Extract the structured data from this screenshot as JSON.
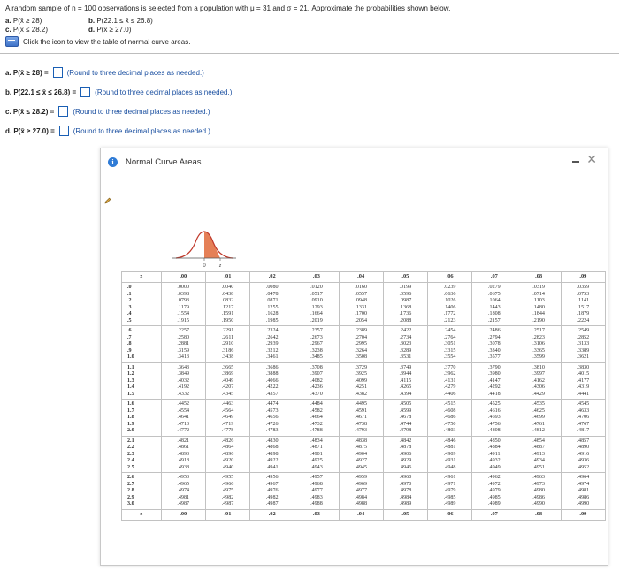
{
  "question": {
    "intro": "A random sample of n = 100 observations is selected from a population with μ = 31 and σ = 21. Approximate the probabilities shown below.",
    "parts": [
      {
        "label": "a.",
        "expr": "P(x̄ ≥ 28)"
      },
      {
        "label": "b.",
        "expr": "P(22.1 ≤ x̄ ≤ 26.8)"
      },
      {
        "label": "c.",
        "expr": "P(x̄ ≤ 28.2)"
      },
      {
        "label": "d.",
        "expr": "P(x̄ ≥ 27.0)"
      }
    ],
    "icon_note": "Click the icon to view the table of normal curve areas."
  },
  "answers": [
    {
      "label": "a. P(x̄ ≥ 28) =",
      "hint": "(Round to three decimal places as needed.)"
    },
    {
      "label": "b. P(22.1 ≤ x̄ ≤ 26.8) =",
      "hint": "(Round to three decimal places as needed.)"
    },
    {
      "label": "c. P(x̄ ≤ 28.2) =",
      "hint": "(Round to three decimal places as needed.)"
    },
    {
      "label": "d. P(x̄ ≥ 27.0) =",
      "hint": "(Round to three decimal places as needed.)"
    }
  ],
  "dialog": {
    "title": "Normal Curve Areas",
    "icons": {
      "info": "info-icon",
      "minimize": "minimize-icon",
      "close": "close-icon",
      "edit": "pencil-icon"
    },
    "curve_labels": {
      "zero": "0",
      "z": "z"
    },
    "table": {
      "headers": [
        "z",
        ".00",
        ".01",
        ".02",
        ".03",
        ".04",
        ".05",
        ".06",
        ".07",
        ".08",
        ".09"
      ],
      "footer": [
        "z",
        ".00",
        ".01",
        ".02",
        ".03",
        ".04",
        ".05",
        ".06",
        ".07",
        ".08",
        ".09"
      ],
      "groups": [
        {
          "z": [
            ".0",
            ".1",
            ".2",
            ".3",
            ".4",
            ".5"
          ],
          "cols": [
            [
              ".0000",
              ".0398",
              ".0793",
              ".1179",
              ".1554",
              ".1915"
            ],
            [
              ".0040",
              ".0438",
              ".0832",
              ".1217",
              ".1591",
              ".1950"
            ],
            [
              ".0080",
              ".0478",
              ".0871",
              ".1255",
              ".1628",
              ".1985"
            ],
            [
              ".0120",
              ".0517",
              ".0910",
              ".1293",
              ".1664",
              ".2019"
            ],
            [
              ".0160",
              ".0557",
              ".0948",
              ".1331",
              ".1700",
              ".2054"
            ],
            [
              ".0199",
              ".0596",
              ".0987",
              ".1368",
              ".1736",
              ".2088"
            ],
            [
              ".0239",
              ".0636",
              ".1026",
              ".1406",
              ".1772",
              ".2123"
            ],
            [
              ".0279",
              ".0675",
              ".1064",
              ".1443",
              ".1808",
              ".2157"
            ],
            [
              ".0319",
              ".0714",
              ".1103",
              ".1480",
              ".1844",
              ".2190"
            ],
            [
              ".0359",
              ".0753",
              ".1141",
              ".1517",
              ".1879",
              ".2224"
            ]
          ]
        },
        {
          "z": [
            ".6",
            ".7",
            ".8",
            ".9",
            "1.0"
          ],
          "cols": [
            [
              ".2257",
              ".2580",
              ".2881",
              ".3159",
              ".3413"
            ],
            [
              ".2291",
              ".2611",
              ".2910",
              ".3186",
              ".3438"
            ],
            [
              ".2324",
              ".2642",
              ".2939",
              ".3212",
              ".3461"
            ],
            [
              ".2357",
              ".2673",
              ".2967",
              ".3238",
              ".3485"
            ],
            [
              ".2389",
              ".2704",
              ".2995",
              ".3264",
              ".3508"
            ],
            [
              ".2422",
              ".2734",
              ".3023",
              ".3289",
              ".3531"
            ],
            [
              ".2454",
              ".2764",
              ".3051",
              ".3315",
              ".3554"
            ],
            [
              ".2486",
              ".2794",
              ".3078",
              ".3340",
              ".3577"
            ],
            [
              ".2517",
              ".2823",
              ".3106",
              ".3365",
              ".3599"
            ],
            [
              ".2549",
              ".2852",
              ".3133",
              ".3389",
              ".3621"
            ]
          ]
        },
        {
          "z": [
            "1.1",
            "1.2",
            "1.3",
            "1.4",
            "1.5"
          ],
          "cols": [
            [
              ".3643",
              ".3849",
              ".4032",
              ".4192",
              ".4332"
            ],
            [
              ".3665",
              ".3869",
              ".4049",
              ".4207",
              ".4345"
            ],
            [
              ".3686",
              ".3888",
              ".4066",
              ".4222",
              ".4357"
            ],
            [
              ".3708",
              ".3907",
              ".4082",
              ".4236",
              ".4370"
            ],
            [
              ".3729",
              ".3925",
              ".4099",
              ".4251",
              ".4382"
            ],
            [
              ".3749",
              ".3944",
              ".4115",
              ".4265",
              ".4394"
            ],
            [
              ".3770",
              ".3962",
              ".4131",
              ".4279",
              ".4406"
            ],
            [
              ".3790",
              ".3980",
              ".4147",
              ".4292",
              ".4418"
            ],
            [
              ".3810",
              ".3997",
              ".4162",
              ".4306",
              ".4429"
            ],
            [
              ".3830",
              ".4015",
              ".4177",
              ".4319",
              ".4441"
            ]
          ]
        },
        {
          "z": [
            "1.6",
            "1.7",
            "1.8",
            "1.9",
            "2.0"
          ],
          "cols": [
            [
              ".4452",
              ".4554",
              ".4641",
              ".4713",
              ".4772"
            ],
            [
              ".4463",
              ".4564",
              ".4649",
              ".4719",
              ".4778"
            ],
            [
              ".4474",
              ".4573",
              ".4656",
              ".4726",
              ".4783"
            ],
            [
              ".4484",
              ".4582",
              ".4664",
              ".4732",
              ".4788"
            ],
            [
              ".4495",
              ".4591",
              ".4671",
              ".4738",
              ".4793"
            ],
            [
              ".4505",
              ".4599",
              ".4678",
              ".4744",
              ".4798"
            ],
            [
              ".4515",
              ".4608",
              ".4686",
              ".4750",
              ".4803"
            ],
            [
              ".4525",
              ".4616",
              ".4693",
              ".4756",
              ".4808"
            ],
            [
              ".4535",
              ".4625",
              ".4699",
              ".4761",
              ".4812"
            ],
            [
              ".4545",
              ".4633",
              ".4706",
              ".4767",
              ".4817"
            ]
          ]
        },
        {
          "z": [
            "2.1",
            "2.2",
            "2.3",
            "2.4",
            "2.5"
          ],
          "cols": [
            [
              ".4821",
              ".4861",
              ".4893",
              ".4918",
              ".4938"
            ],
            [
              ".4826",
              ".4864",
              ".4896",
              ".4920",
              ".4940"
            ],
            [
              ".4830",
              ".4868",
              ".4898",
              ".4922",
              ".4941"
            ],
            [
              ".4834",
              ".4871",
              ".4901",
              ".4925",
              ".4943"
            ],
            [
              ".4838",
              ".4875",
              ".4904",
              ".4927",
              ".4945"
            ],
            [
              ".4842",
              ".4878",
              ".4906",
              ".4929",
              ".4946"
            ],
            [
              ".4846",
              ".4881",
              ".4909",
              ".4931",
              ".4948"
            ],
            [
              ".4850",
              ".4884",
              ".4911",
              ".4932",
              ".4949"
            ],
            [
              ".4854",
              ".4887",
              ".4913",
              ".4934",
              ".4951"
            ],
            [
              ".4857",
              ".4890",
              ".4916",
              ".4936",
              ".4952"
            ]
          ]
        },
        {
          "z": [
            "2.6",
            "2.7",
            "2.8",
            "2.9",
            "3.0"
          ],
          "cols": [
            [
              ".4953",
              ".4965",
              ".4974",
              ".4981",
              ".4987"
            ],
            [
              ".4955",
              ".4966",
              ".4975",
              ".4982",
              ".4987"
            ],
            [
              ".4956",
              ".4967",
              ".4976",
              ".4982",
              ".4987"
            ],
            [
              ".4957",
              ".4968",
              ".4977",
              ".4983",
              ".4988"
            ],
            [
              ".4959",
              ".4969",
              ".4977",
              ".4984",
              ".4988"
            ],
            [
              ".4960",
              ".4970",
              ".4978",
              ".4984",
              ".4989"
            ],
            [
              ".4961",
              ".4971",
              ".4979",
              ".4985",
              ".4989"
            ],
            [
              ".4962",
              ".4972",
              ".4979",
              ".4985",
              ".4989"
            ],
            [
              ".4963",
              ".4973",
              ".4980",
              ".4986",
              ".4990"
            ],
            [
              ".4964",
              ".4974",
              ".4981",
              ".4986",
              ".4990"
            ]
          ]
        }
      ]
    }
  },
  "colors": {
    "accent": "#1a5fb4",
    "curve_fill": "#e06a3a",
    "curve_stroke": "#c0392b",
    "info": "#2f7bd6"
  }
}
